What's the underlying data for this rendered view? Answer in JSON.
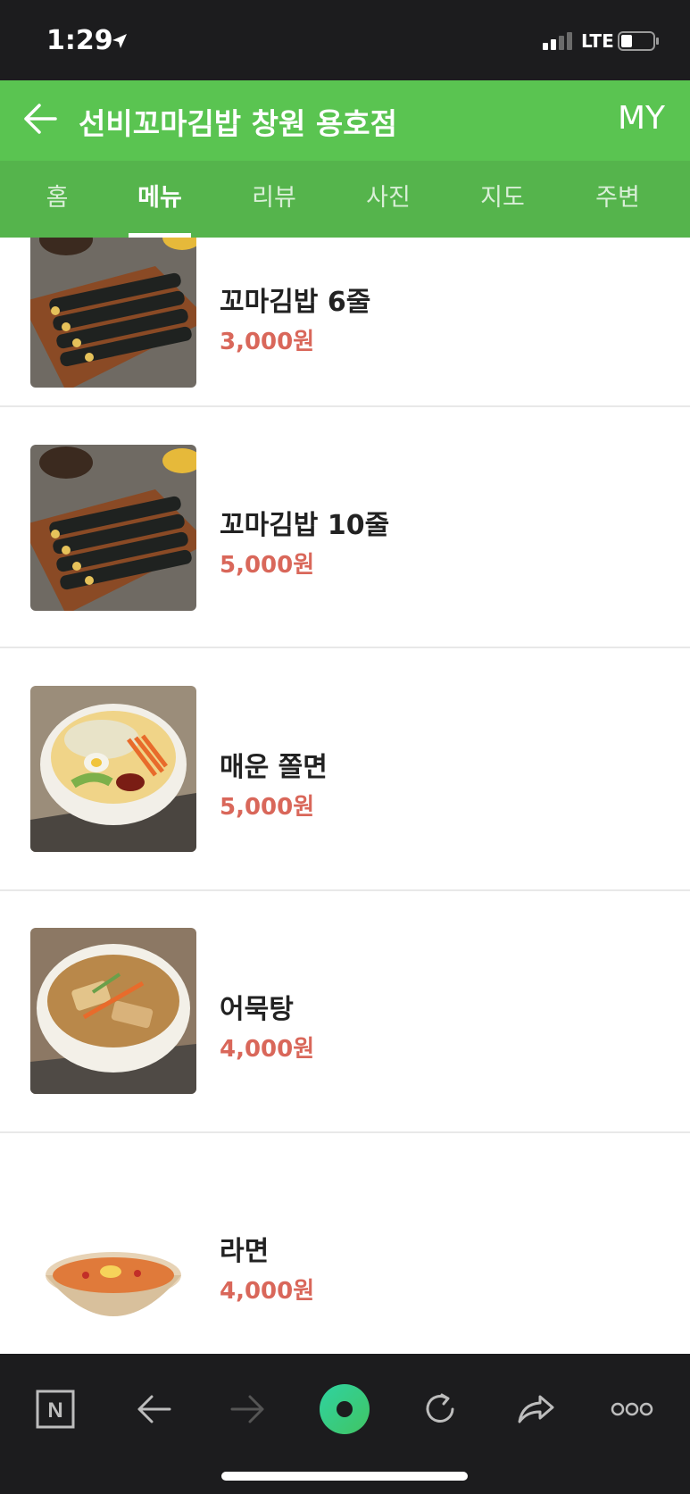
{
  "status_bar": {
    "time": "1:29",
    "network": "LTE"
  },
  "header": {
    "title": "선비꼬마김밥 창원 용호점",
    "my_label": "MY"
  },
  "tabs": [
    {
      "label": "홈",
      "active": false
    },
    {
      "label": "메뉴",
      "active": true
    },
    {
      "label": "리뷰",
      "active": false
    },
    {
      "label": "사진",
      "active": false
    },
    {
      "label": "지도",
      "active": false
    },
    {
      "label": "주변",
      "active": false
    }
  ],
  "menu_items": [
    {
      "name": "꼬마김밥 6줄",
      "price": "3,000원"
    },
    {
      "name": "꼬마김밥 10줄",
      "price": "5,000원"
    },
    {
      "name": "매운 쫄면",
      "price": "5,000원"
    },
    {
      "name": "어묵탕",
      "price": "4,000원"
    },
    {
      "name": "라면",
      "price": "4,000원"
    }
  ],
  "bottom_nav": [
    {
      "icon": "naver-n-icon",
      "label": "N"
    },
    {
      "icon": "back-arrow-icon"
    },
    {
      "icon": "forward-arrow-icon",
      "disabled": true
    },
    {
      "icon": "green-dot-icon"
    },
    {
      "icon": "refresh-icon"
    },
    {
      "icon": "share-icon"
    },
    {
      "icon": "more-icon"
    }
  ],
  "colors": {
    "header_green": "#5ac451",
    "tab_green": "#55b44c",
    "price_red": "#d9675a",
    "dark_bar": "#1c1c1e"
  }
}
